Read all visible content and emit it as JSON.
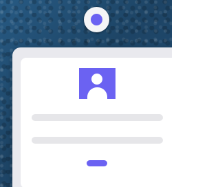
{
  "scene": {
    "description_icons": [
      "lanyard-hole-icon",
      "avatar-icon"
    ],
    "colors": {
      "background": "#1f4a6e",
      "accent": "#6b62f2",
      "card_frame": "#e9e9ee",
      "card_face": "#ffffff",
      "placeholder_line": "#e6e6e9"
    }
  },
  "card": {
    "avatar_icon": "user-avatar-icon",
    "placeholder_lines": 2,
    "button_label": ""
  }
}
